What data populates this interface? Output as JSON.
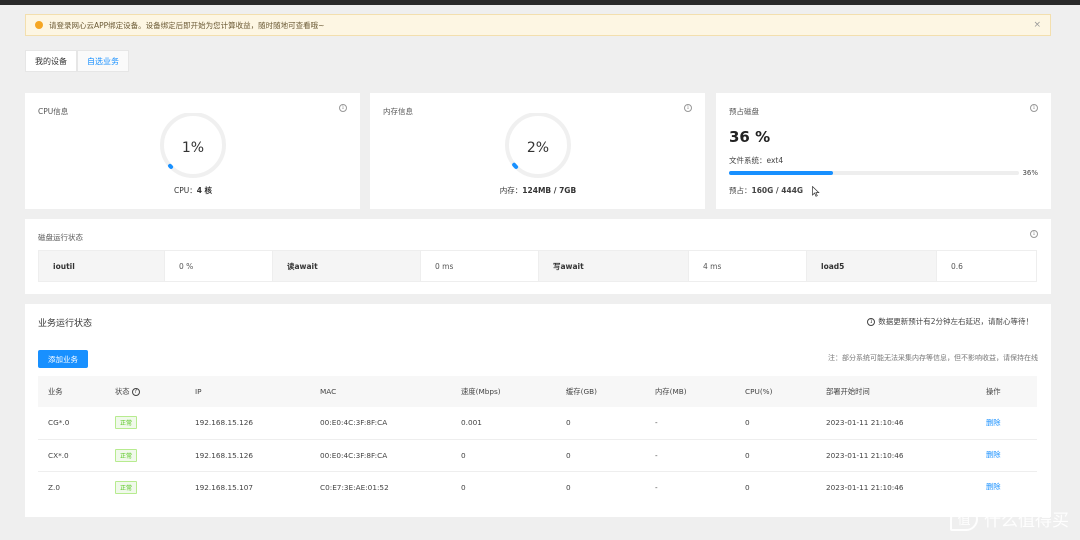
{
  "notice": {
    "text": "请登录网心云APP绑定设备。设备绑定后即开始为您计算收益，随时随地可查看哦~",
    "close": "×"
  },
  "tabs": [
    {
      "label": "我的设备",
      "active": false
    },
    {
      "label": "自选业务",
      "active": true
    }
  ],
  "cpu": {
    "title": "CPU信息",
    "percent_text": "1%",
    "percent": 1,
    "caption_label": "CPU：",
    "caption_value": "4 核"
  },
  "memory": {
    "title": "内存信息",
    "percent_text": "2%",
    "percent": 2,
    "caption_label": "内存：",
    "caption_value": "124MB / 7GB"
  },
  "disk": {
    "title": "预占磁盘",
    "percent_text": "36 %",
    "percent": 36,
    "fs_label": "文件系统：ext4",
    "bar_label": "36%",
    "used_label": "预占：",
    "used_value": "160G / 444G"
  },
  "disk_status": {
    "title": "磁盘运行状态",
    "metrics": [
      {
        "key": "ioutil",
        "value": "0 %"
      },
      {
        "key": "读await",
        "value": "0 ms"
      },
      {
        "key": "写await",
        "value": "4 ms"
      },
      {
        "key": "load5",
        "value": "0.6"
      }
    ]
  },
  "services": {
    "title": "业务运行状态",
    "tip": "数据更新预计有2分钟左右延迟，请耐心等待！",
    "add_button": "添加业务",
    "note": "注：部分系统可能无法采集内存等信息，但不影响收益，请保持在线",
    "columns": [
      "业务",
      "状态",
      "IP",
      "MAC",
      "速度(Mbps)",
      "缓存(GB)",
      "内存(MB)",
      "CPU(%)",
      "部署开始时间",
      "操作"
    ],
    "rows": [
      {
        "name": "CG*.0",
        "status": "正常",
        "ip": "192.168.15.126",
        "mac": "00:E0:4C:3F:8F:CA",
        "speed": "0.001",
        "cache": "0",
        "mem": "-",
        "cpu": "0",
        "time": "2023-01-11 21:10:46",
        "action": "删除"
      },
      {
        "name": "CX*.0",
        "status": "正常",
        "ip": "192.168.15.126",
        "mac": "00:E0:4C:3F:8F:CA",
        "speed": "0",
        "cache": "0",
        "mem": "-",
        "cpu": "0",
        "time": "2023-01-11 21:10:46",
        "action": "删除"
      },
      {
        "name": "Z.0",
        "status": "正常",
        "ip": "192.168.15.107",
        "mac": "C0:E7:3E:AE:01:52",
        "speed": "0",
        "cache": "0",
        "mem": "-",
        "cpu": "0",
        "time": "2023-01-11 21:10:46",
        "action": "删除"
      }
    ]
  },
  "watermark": {
    "logo": "值",
    "text": "什么值得买"
  },
  "colors": {
    "accent": "#1890ff",
    "success": "#52c41a",
    "warning": "#f5a623"
  }
}
